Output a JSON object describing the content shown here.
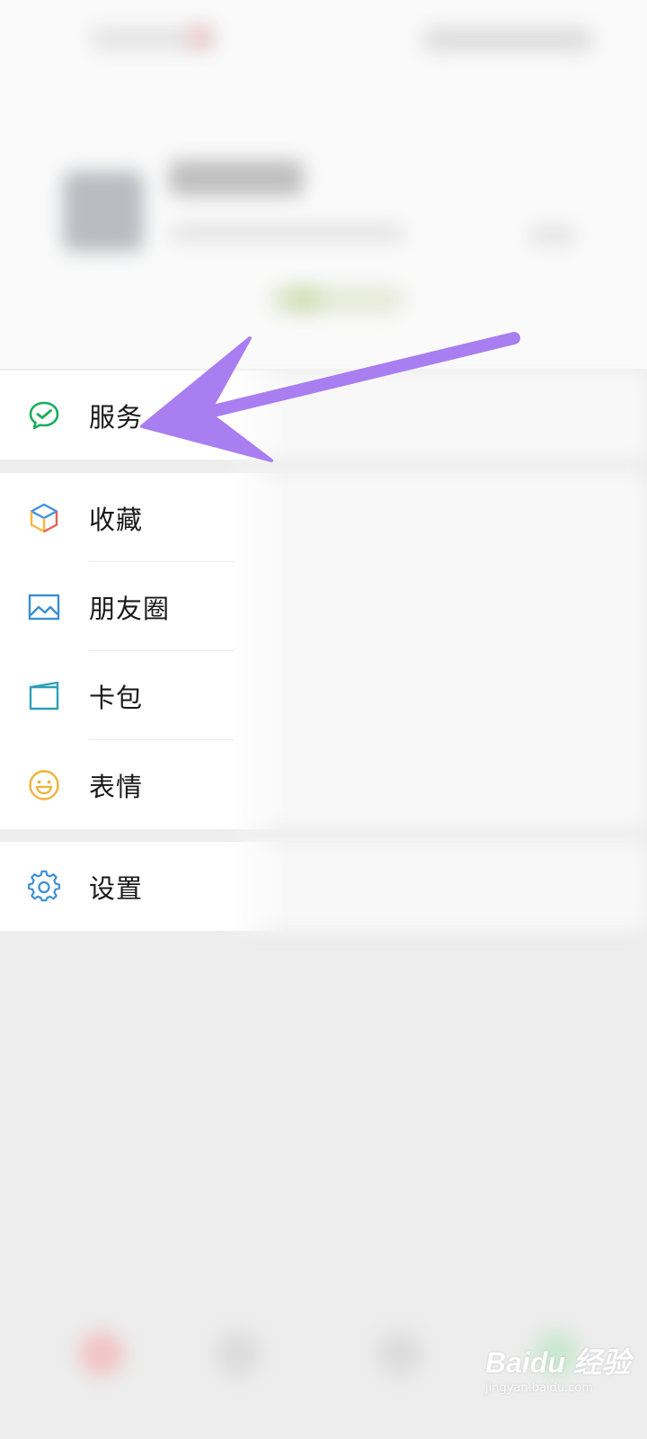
{
  "menu": {
    "group1": [
      {
        "id": "services",
        "label": "服务",
        "icon": "wechat-pay-icon"
      }
    ],
    "group2": [
      {
        "id": "favorites",
        "label": "收藏",
        "icon": "cube-icon"
      },
      {
        "id": "moments",
        "label": "朋友圈",
        "icon": "picture-icon"
      },
      {
        "id": "cards",
        "label": "卡包",
        "icon": "wallet-icon"
      },
      {
        "id": "stickers",
        "label": "表情",
        "icon": "smiley-icon"
      }
    ],
    "group3": [
      {
        "id": "settings",
        "label": "设置",
        "icon": "gear-icon"
      }
    ]
  },
  "annotation": {
    "arrow_color": "#a97ef0",
    "points_to": "services"
  },
  "watermark": {
    "logo": "Baidu 经验",
    "url": "jingyan.baidu.com"
  },
  "colors": {
    "wechat_green": "#07c160",
    "background": "#ededed"
  }
}
